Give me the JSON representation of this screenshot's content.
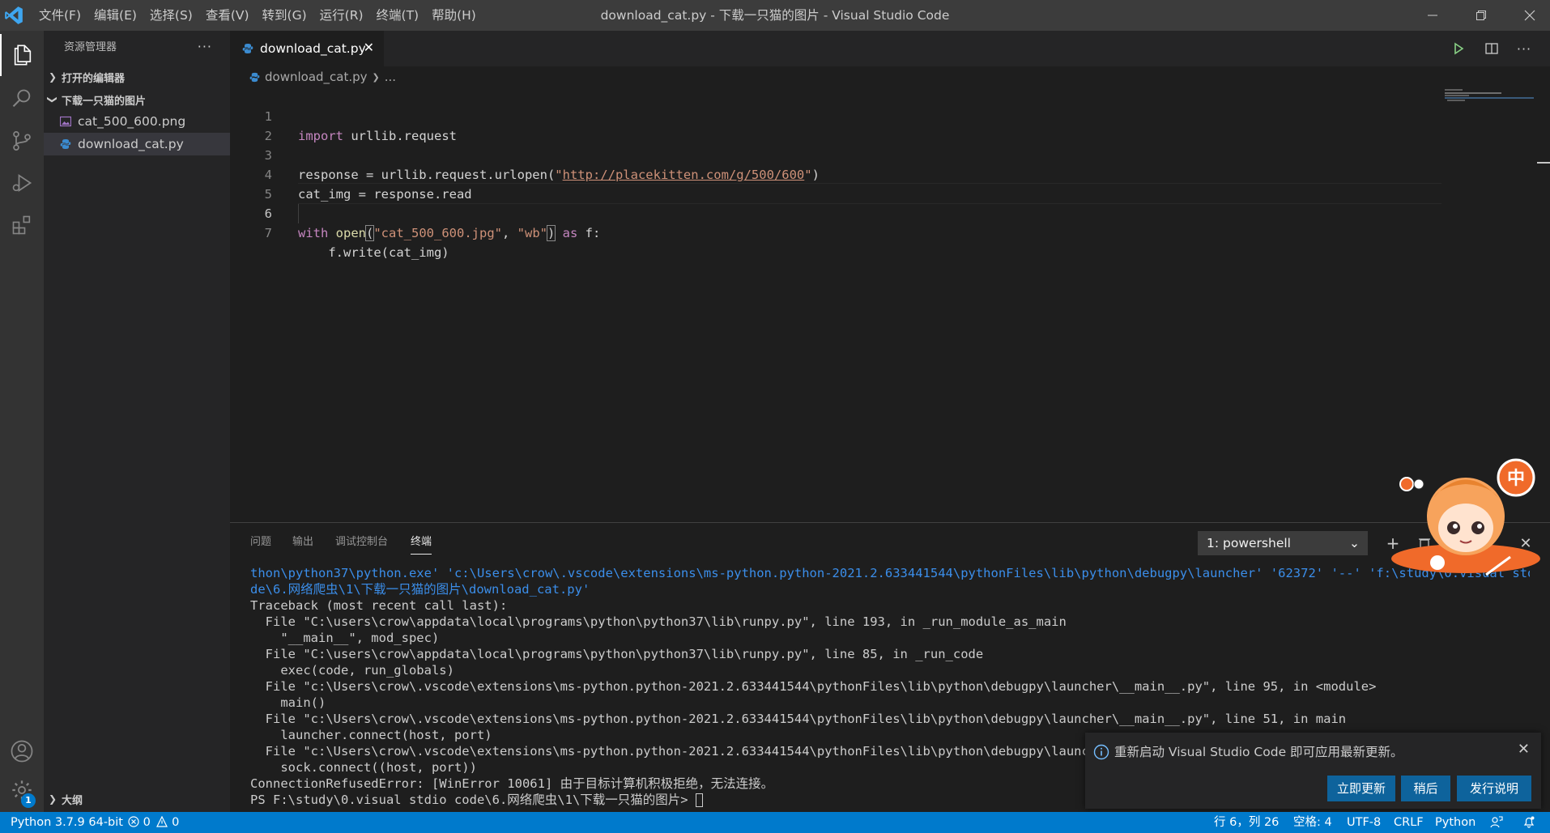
{
  "titlebar": {
    "menus": [
      "文件(F)",
      "编辑(E)",
      "选择(S)",
      "查看(V)",
      "转到(G)",
      "运行(R)",
      "终端(T)",
      "帮助(H)"
    ],
    "window_title": "download_cat.py - 下载一只猫的图片 - Visual Studio Code"
  },
  "sidebar": {
    "title": "资源管理器",
    "more": "···",
    "open_editors": "打开的编辑器",
    "folder": "下载一只猫的图片",
    "files": [
      {
        "name": "cat_500_600.png",
        "icon": "image-file-icon"
      },
      {
        "name": "download_cat.py",
        "icon": "python-file-icon",
        "selected": true
      }
    ],
    "outline": "大纲"
  },
  "editor": {
    "tab_label": "download_cat.py",
    "breadcrumb_file": "download_cat.py",
    "breadcrumb_more": "...",
    "line_numbers": [
      "1",
      "2",
      "3",
      "4",
      "5",
      "6",
      "7"
    ],
    "current_line": 6,
    "code": {
      "l1_kw": "import",
      "l1_rest": " urllib.request",
      "l3_a": "response = urllib.request.urlopen(",
      "l3_q1": "\"",
      "l3_url": "http://placekitten.com/g/500/600",
      "l3_q2": "\"",
      "l3_b": ")",
      "l4": "cat_img = response.read",
      "l6_kw": "with",
      "l6_fn": "open",
      "l6_p1": "(",
      "l6_s1": "\"cat_500_600.jpg\"",
      "l6_comma": ", ",
      "l6_s2": "\"wb\"",
      "l6_p2": ")",
      "l6_as": "as",
      "l6_rest": " f:",
      "l7": "    f.write(cat_img)"
    }
  },
  "panel": {
    "tabs": [
      "问题",
      "输出",
      "调试控制台",
      "终端"
    ],
    "active_tab": "终端",
    "terminal_select": "1: powershell",
    "terminal_lines": [
      "thon\\python37\\python.exe' 'c:\\Users\\crow\\.vscode\\extensions\\ms-python.python-2021.2.633441544\\pythonFiles\\lib\\python\\debugpy\\launcher' '62372' '--' 'f:\\study\\0.visual stdio co",
      "de\\6.网络爬虫\\1\\下载一只猫的图片\\download_cat.py'",
      "Traceback (most recent call last):",
      "  File \"C:\\users\\crow\\appdata\\local\\programs\\python\\python37\\lib\\runpy.py\", line 193, in _run_module_as_main",
      "    \"__main__\", mod_spec)",
      "  File \"C:\\users\\crow\\appdata\\local\\programs\\python\\python37\\lib\\runpy.py\", line 85, in _run_code",
      "    exec(code, run_globals)",
      "  File \"c:\\Users\\crow\\.vscode\\extensions\\ms-python.python-2021.2.633441544\\pythonFiles\\lib\\python\\debugpy\\launcher\\__main__.py\", line 95, in <module>",
      "    main()",
      "  File \"c:\\Users\\crow\\.vscode\\extensions\\ms-python.python-2021.2.633441544\\pythonFiles\\lib\\python\\debugpy\\launcher\\__main__.py\", line 51, in main",
      "    launcher.connect(host, port)",
      "  File \"c:\\Users\\crow\\.vscode\\extensions\\ms-python.python-2021.2.633441544\\pythonFiles\\lib\\python\\debugpy\\launcher/",
      "    sock.connect((host, port))",
      "ConnectionRefusedError: [WinError 10061] 由于目标计算机积极拒绝，无法连接。",
      "PS F:\\study\\0.visual stdio code\\6.网络爬虫\\1\\下载一只猫的图片> "
    ],
    "terminal_line_colors": [
      "blue",
      "blue",
      "",
      "",
      "",
      "",
      "",
      "",
      "",
      "",
      "",
      "",
      "",
      "",
      ""
    ]
  },
  "notification": {
    "message": "重新启动 Visual Studio Code 即可应用最新更新。",
    "buttons": [
      "立即更新",
      "稍后",
      "发行说明"
    ]
  },
  "statusbar": {
    "python": "Python 3.7.9 64-bit",
    "errors": "0",
    "warnings": "0",
    "position": "行 6，列 26",
    "spaces": "空格: 4",
    "encoding": "UTF-8",
    "eol": "CRLF",
    "language": "Python"
  },
  "badges": {
    "accounts_settings": "1"
  },
  "colors": {
    "accent": "#007acc",
    "button": "#0e639c",
    "keyword": "#c586c0",
    "string": "#ce9178",
    "function": "#dcdcaa"
  }
}
